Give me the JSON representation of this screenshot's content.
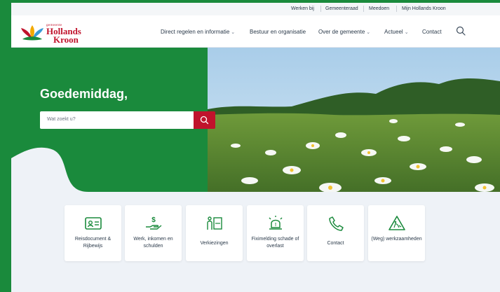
{
  "topbar": {
    "links": [
      "Werken bij",
      "Gemeenteraad",
      "Meedoen",
      "Mijn Hollands Kroon"
    ]
  },
  "logo": {
    "small_text": "gemeente",
    "name_line1": "Hollands",
    "name_line2": "Kroon",
    "colors": [
      "#c0132c",
      "#1a8a3c",
      "#f2a900",
      "#3a9bd8"
    ]
  },
  "nav": {
    "items": [
      {
        "label": "Direct regelen en informatie",
        "dropdown": true
      },
      {
        "label": "Bestuur en organisatie",
        "dropdown": false
      },
      {
        "label": "Over de gemeente",
        "dropdown": true
      },
      {
        "label": "Actueel",
        "dropdown": true
      },
      {
        "label": "Contact",
        "dropdown": false
      }
    ],
    "search_icon": "search-icon"
  },
  "hero": {
    "greeting": "Goedemiddag,",
    "search_placeholder": "Wat zoekt u?",
    "submit_icon": "search-icon",
    "photo": "meadow-with-daisies"
  },
  "tiles": [
    {
      "label": "Reisdocument & Rijbewijs",
      "icon": "id-card-icon"
    },
    {
      "label": "Werk, inkomen en schulden",
      "icon": "money-hand-icon"
    },
    {
      "label": "Verkiezingen",
      "icon": "voting-icon"
    },
    {
      "label": "Fiximelding schade of overlast",
      "icon": "alarm-light-icon"
    },
    {
      "label": "Contact",
      "icon": "phone-icon"
    },
    {
      "label": "(Weg) werkzaamheden",
      "icon": "roadworks-icon"
    }
  ],
  "colors": {
    "brand_green": "#1a8a3c",
    "brand_red": "#c0132c",
    "page_bg": "#eef2f7"
  }
}
